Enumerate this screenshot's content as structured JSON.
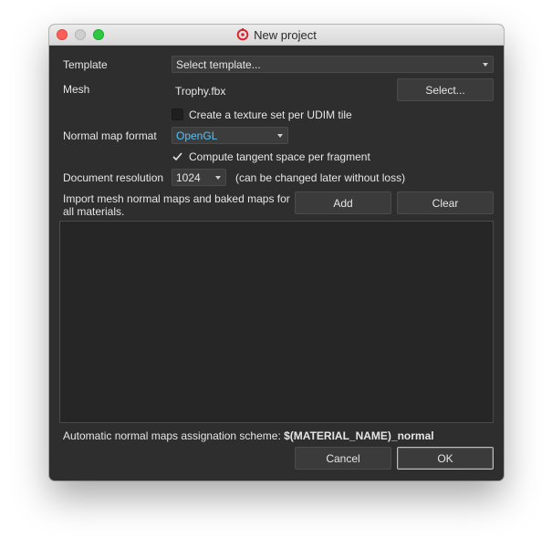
{
  "window": {
    "title": "New project"
  },
  "form": {
    "template_label": "Template",
    "template_value": "Select template...",
    "mesh_label": "Mesh",
    "mesh_value": "Trophy.fbx",
    "mesh_select_button": "Select...",
    "udim_checkbox_label": "Create a texture set per UDIM tile",
    "udim_checked": false,
    "normal_format_label": "Normal map format",
    "normal_format_value": "OpenGL",
    "tangent_checkbox_label": "Compute tangent space per fragment",
    "tangent_checked": true,
    "resolution_label": "Document resolution",
    "resolution_value": "1024",
    "resolution_note": "(can be changed later without loss)",
    "import_label_line1": "Import mesh normal maps and baked maps for",
    "import_label_line2": "all materials.",
    "add_button": "Add",
    "clear_button": "Clear"
  },
  "footer": {
    "scheme_label": "Automatic normal maps assignation scheme:",
    "scheme_value": "$(MATERIAL_NAME)_normal",
    "cancel_button": "Cancel",
    "ok_button": "OK"
  },
  "colors": {
    "accent_text": "#4fc3ff",
    "panel_bg": "#2e2e2e",
    "close_button": "#fc5f57",
    "maximize_button": "#2bc840"
  },
  "icons": {
    "app": "substance-painter-icon",
    "checkmark": "checkmark-icon",
    "dropdown": "chevron-down-icon"
  }
}
